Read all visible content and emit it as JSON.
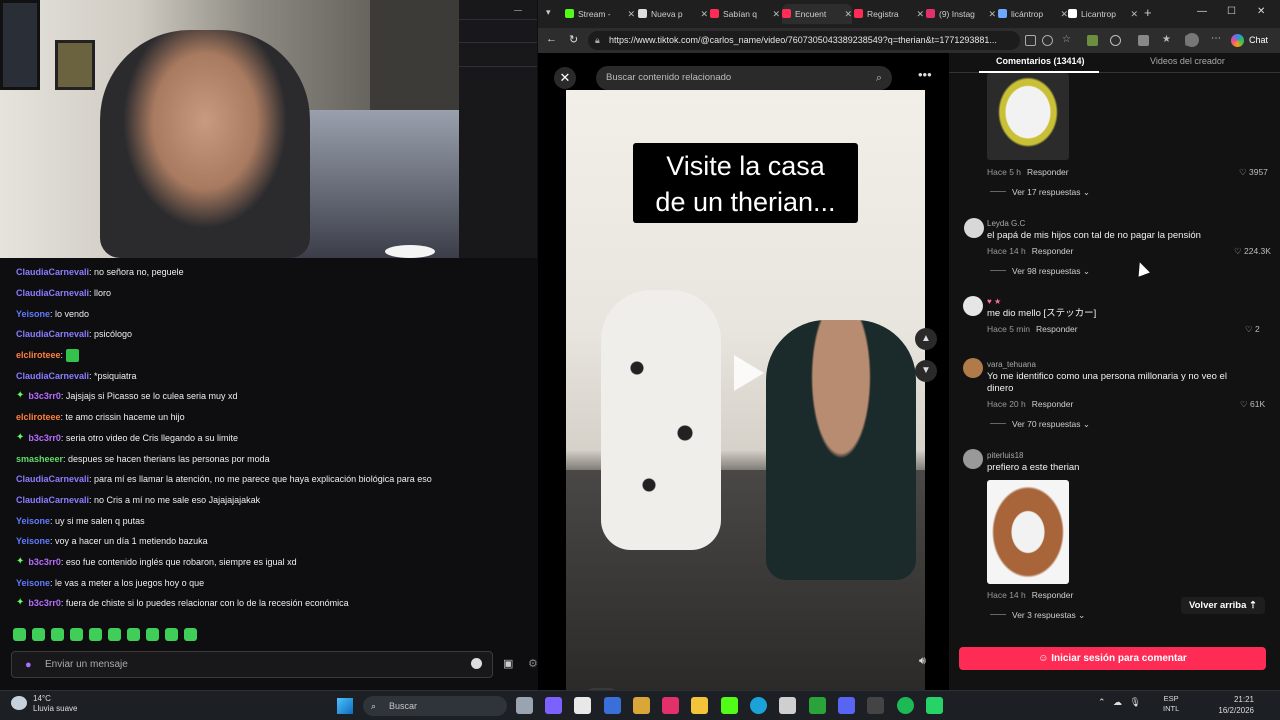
{
  "stream": {
    "chat_messages": [
      {
        "user": "ClaudiaCarnevali",
        "text": ": no señora no, peguele",
        "color": "claudia",
        "badge": false,
        "emote": false
      },
      {
        "user": "ClaudiaCarnevali",
        "text": ": lloro",
        "color": "claudia",
        "badge": false,
        "emote": false
      },
      {
        "user": "Yeisone",
        "text": ": lo vendo",
        "color": "yeisone",
        "badge": false,
        "emote": false
      },
      {
        "user": "ClaudiaCarnevali",
        "text": ": psicólogo",
        "color": "claudia",
        "badge": false,
        "emote": false
      },
      {
        "user": "elcliroteee",
        "text": ":",
        "color": "elcl",
        "badge": false,
        "emote": true
      },
      {
        "user": "ClaudiaCarnevali",
        "text": ": *psiquiatra",
        "color": "claudia",
        "badge": false,
        "emote": false
      },
      {
        "user": "b3c3rr0",
        "text": ": Jajsjajs si Picasso se lo culea seria muy xd",
        "color": "b3c",
        "badge": true,
        "emote": false
      },
      {
        "user": "elcliroteee",
        "text": ": te amo crissin haceme un hijo",
        "color": "elcl",
        "badge": false,
        "emote": false
      },
      {
        "user": "b3c3rr0",
        "text": ": seria otro video de Cris llegando a su limite",
        "color": "b3c",
        "badge": true,
        "emote": false
      },
      {
        "user": "smasheeer",
        "text": ": despues se hacen therians las personas por moda",
        "color": "smash",
        "badge": false,
        "emote": false
      },
      {
        "user": "ClaudiaCarnevali",
        "text": ": para mí es llamar la atención, no me parece que haya explicación biológica para eso",
        "color": "claudia",
        "badge": false,
        "emote": false
      },
      {
        "user": "ClaudiaCarnevali",
        "text": ": no Cris a mí no me sale eso Jajajajajakak",
        "color": "claudia",
        "badge": false,
        "emote": false
      },
      {
        "user": "Yeisone",
        "text": ": uy si me salen q putas",
        "color": "yeisone",
        "badge": false,
        "emote": false
      },
      {
        "user": "Yeisone",
        "text": ": voy a hacer un día 1 metiendo bazuka",
        "color": "yeisone",
        "badge": false,
        "emote": false
      },
      {
        "user": "b3c3rr0",
        "text": ": eso fue contenido inglés que robaron, siempre es igual xd",
        "color": "b3c",
        "badge": true,
        "emote": false
      },
      {
        "user": "Yeisone",
        "text": ": le vas a meter a los juegos hoy o que",
        "color": "yeisone",
        "badge": false,
        "emote": false
      },
      {
        "user": "b3c3rr0",
        "text": ": fuera de chiste si lo puedes relacionar con lo de la recesión económica",
        "color": "b3c",
        "badge": true,
        "emote": false
      }
    ],
    "chat_input_placeholder": "Enviar un mensaje"
  },
  "browser": {
    "tabs": [
      {
        "label": "Stream -",
        "icon_color": "#53fc18"
      },
      {
        "label": "Nueva p",
        "icon_color": "#dddddd"
      },
      {
        "label": "Sabían q",
        "icon_color": "#ff2d55"
      },
      {
        "label": "Encuent",
        "icon_color": "#ff2d55"
      },
      {
        "label": "Registra",
        "icon_color": "#ff2d55"
      },
      {
        "label": "(9) Instag",
        "icon_color": "#e1306c"
      },
      {
        "label": "licántrop",
        "icon_color": "#6ea8ff"
      },
      {
        "label": "Licantrop",
        "icon_color": "#ffffff"
      }
    ],
    "url": "https://www.tiktok.com/@carlos_name/video/7607305043389238549?q=therian&t=1771293881...",
    "chat_label": "Chat"
  },
  "tiktok": {
    "search_placeholder": "Buscar contenido relacionado",
    "caption_line1": "Visite la casa",
    "caption_line2": "de un therian...",
    "comments_tab": "Comentarios (13414)",
    "creator_tab": "Videos del creador",
    "comments": [
      {
        "name": "",
        "text": "",
        "time": "Hace 5 h",
        "reply": "Responder",
        "likes": "3957",
        "replies": "Ver 17 respuestas"
      },
      {
        "name": "Leyda G.C",
        "text": "el papá de mis hijos con tal de no pagar la pensión",
        "time": "Hace 14 h",
        "reply": "Responder",
        "likes": "224.3K",
        "replies": "Ver 98 respuestas"
      },
      {
        "name": "",
        "text": "me dio mello [ステッカー]",
        "time": "Hace 5 min",
        "reply": "Responder",
        "likes": "2",
        "replies": ""
      },
      {
        "name": "vara_tehuana",
        "text": "Yo me identifico como una persona millonaria y no veo el dinero",
        "time": "Hace 20 h",
        "reply": "Responder",
        "likes": "61K",
        "replies": "Ver 70 respuestas"
      },
      {
        "name": "piterluis18",
        "text": "prefiero a este therian",
        "time": "Hace 14 h",
        "reply": "Responder",
        "likes": "",
        "replies": "Ver 3 respuestas"
      }
    ],
    "back_to_top": "Volver arriba",
    "login_button": "Iniciar sesión para comentar"
  },
  "taskbar": {
    "temperature": "14°C",
    "weather": "Lluvia suave",
    "search": "Buscar",
    "lang1": "ESP",
    "lang2": "INTL",
    "time": "21:21",
    "date": "16/2/2026"
  }
}
